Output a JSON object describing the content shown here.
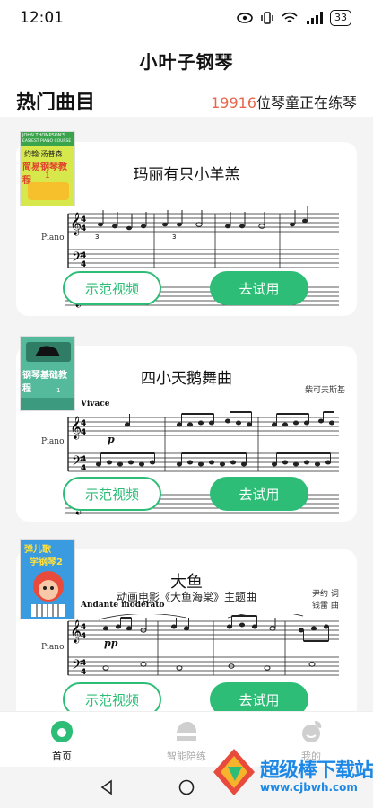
{
  "status_bar": {
    "time": "12:01",
    "battery": "33",
    "signal": "4G"
  },
  "app": {
    "title": "小叶子钢琴"
  },
  "section": {
    "title": "热门曲目",
    "practice_count": "19916",
    "practice_suffix": "位琴童正在练琴"
  },
  "songs": [
    {
      "title": "玛丽有只小羊羔",
      "cover": {
        "top_text": "JOHN THOMPSON'S",
        "top_text2": "EASIEST PIANO COURSE",
        "author": "约翰·汤普森",
        "book_title": "简易钢琴教程",
        "volume": "1"
      },
      "piano_label": "Piano",
      "demo_label": "示范视频",
      "try_label": "去试用"
    },
    {
      "title": "四小天鹅舞曲",
      "composer": "柴可夫斯基",
      "tempo": "Vivace",
      "dynamic": "p",
      "cover": {
        "book_title": "钢琴基础教程",
        "volume": "1"
      },
      "piano_label": "Piano",
      "demo_label": "示范视频",
      "try_label": "去试用"
    },
    {
      "title": "大鱼",
      "subtitle": "动画电影《大鱼海棠》主题曲",
      "lyricist": "尹约 词",
      "composer": "钱雷 曲",
      "tempo": "Andante moderato",
      "dynamic": "pp",
      "cover": {
        "book_title_line1": "弹儿歌",
        "book_title_line2": "学钢琴2"
      },
      "piano_label": "Piano",
      "demo_label": "示范视频",
      "try_label": "去试用"
    }
  ],
  "tabs": [
    {
      "label": "首页",
      "icon": "home-leaf-icon",
      "active": true
    },
    {
      "label": "智能陪练",
      "icon": "ai-practice-icon",
      "active": false
    },
    {
      "label": "我的",
      "icon": "profile-icon",
      "active": false
    }
  ],
  "watermark": {
    "title": "超级棒下载站",
    "url": "www.cjbwh.com"
  },
  "colors": {
    "accent": "#2dbd77",
    "count_highlight": "#e8664d",
    "watermark": "#1d88e5"
  }
}
